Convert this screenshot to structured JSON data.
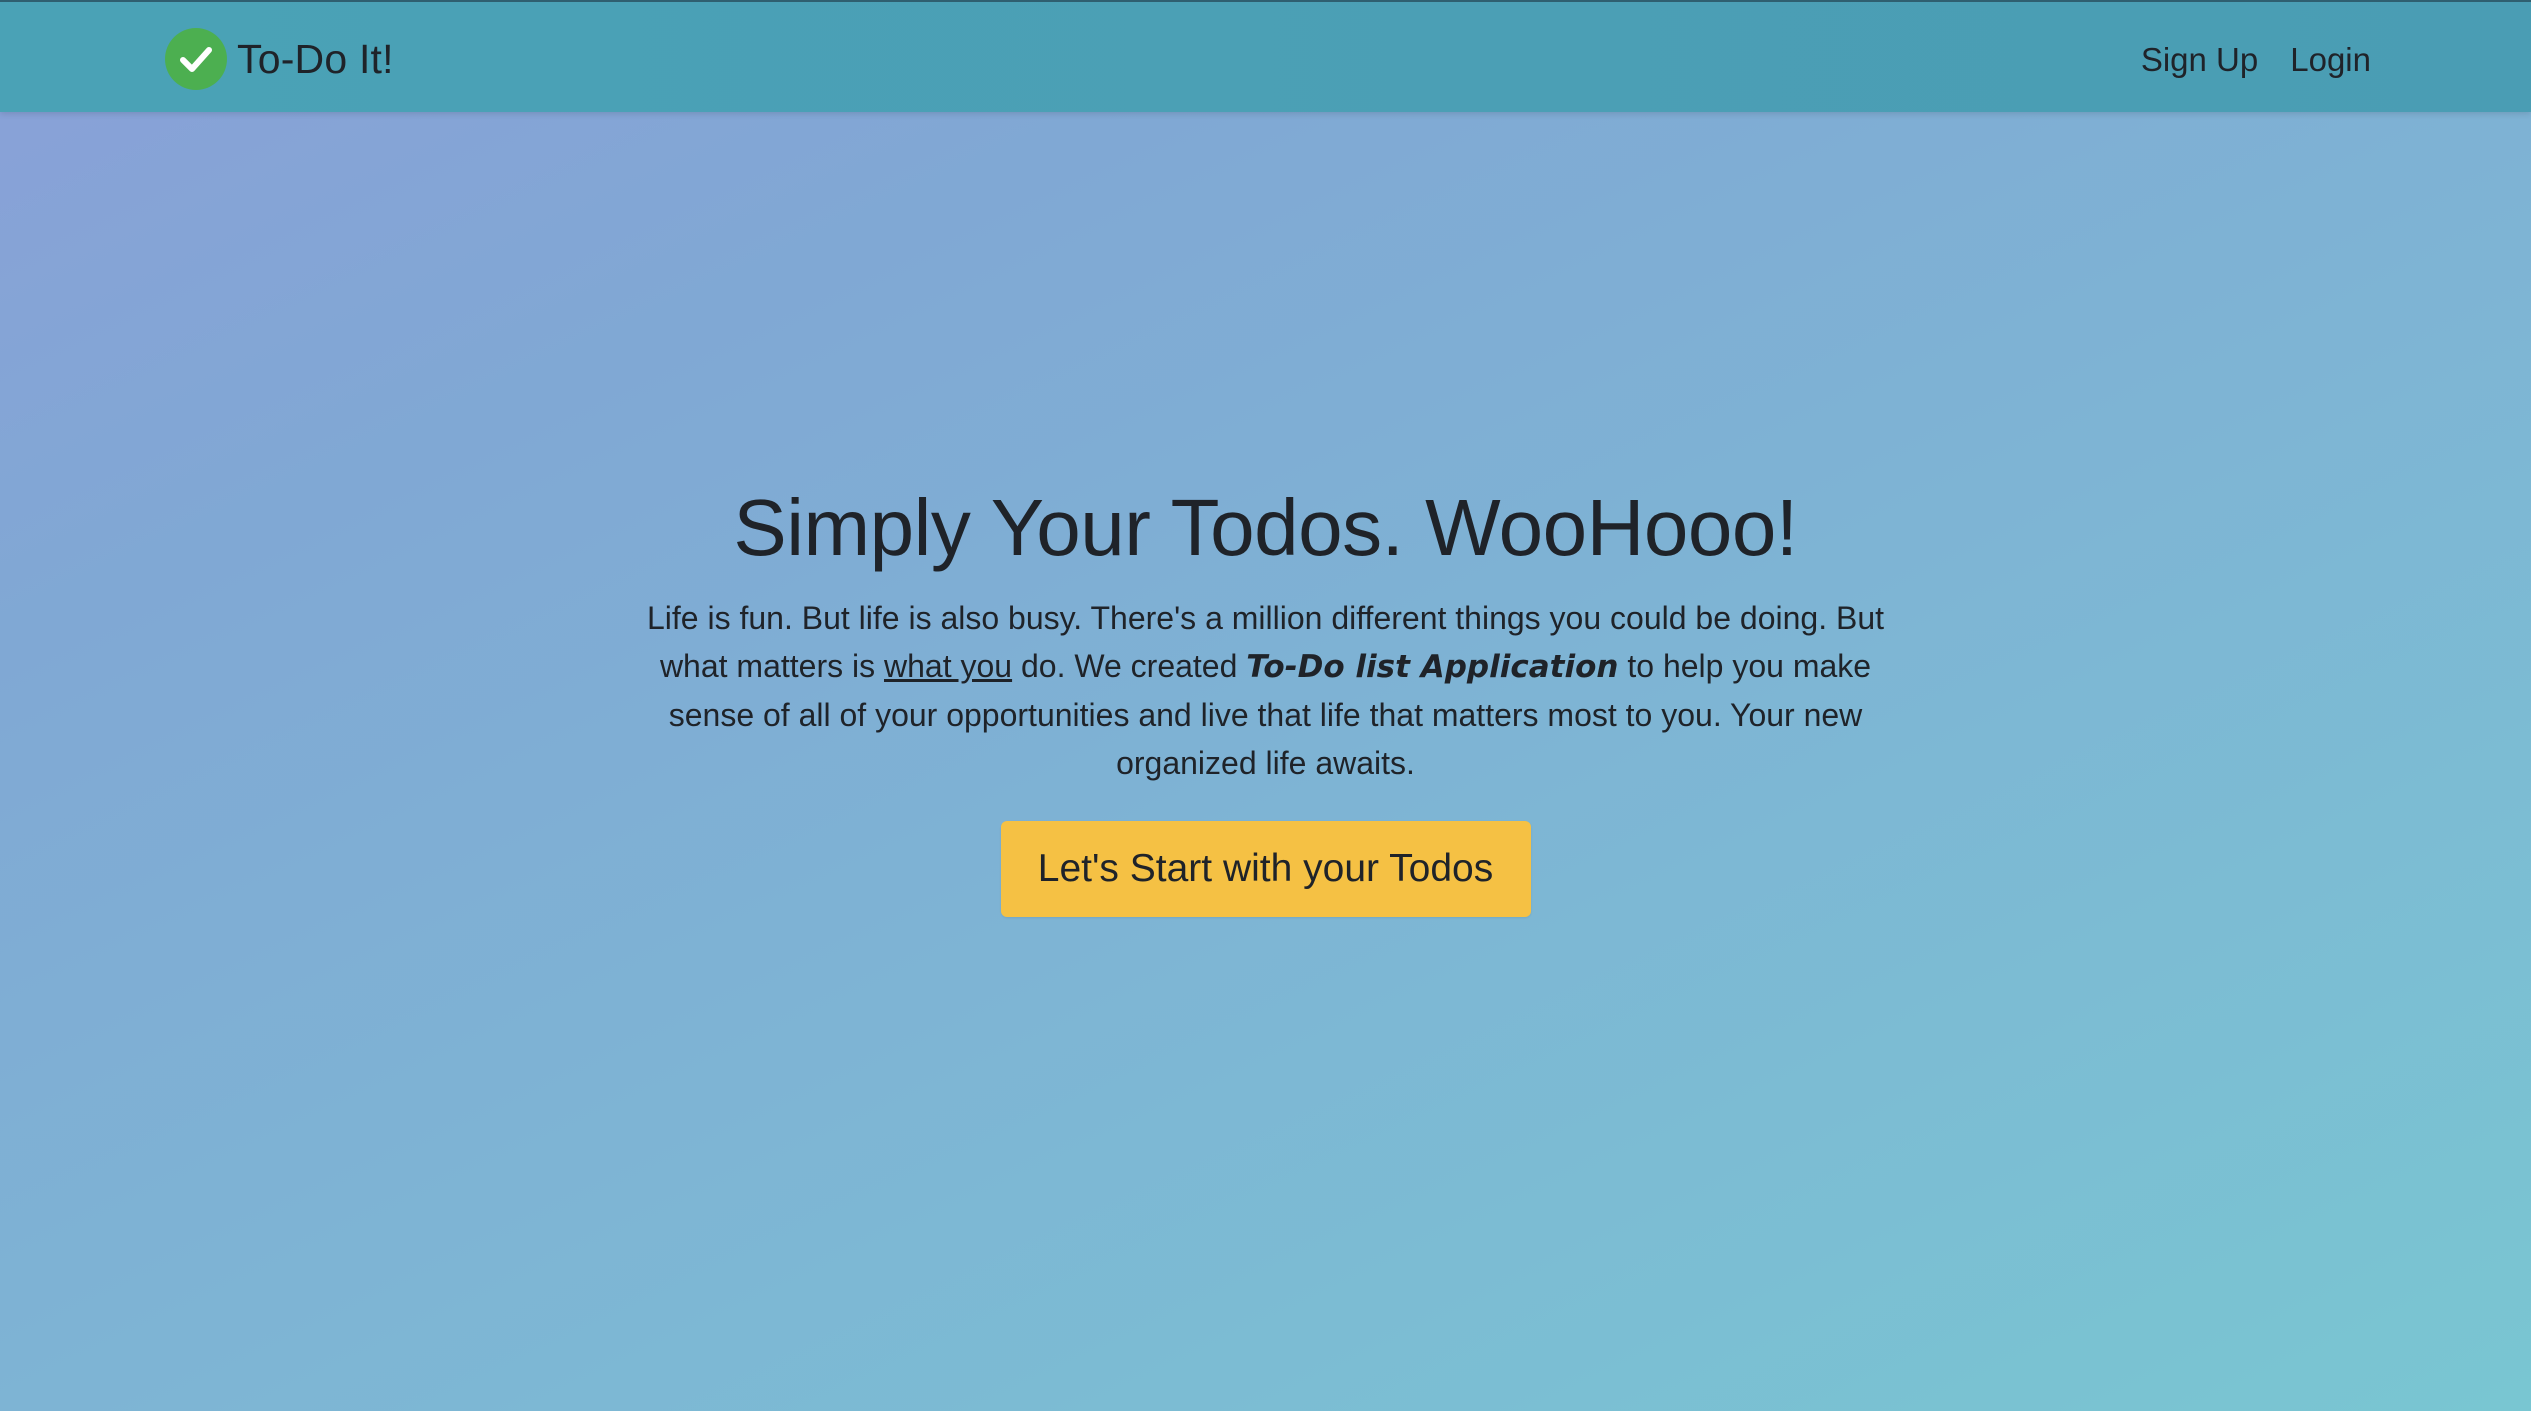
{
  "nav": {
    "brand_name": "To-Do It!",
    "brand_icon": "check-circle-icon",
    "signup_label": "Sign Up",
    "login_label": "Login"
  },
  "hero": {
    "title": "Simply Your Todos. WooHooo!",
    "text_part1": "Life is fun. But life is also busy. There's a million different things you could be doing. But what matters is ",
    "text_underlined": "what you",
    "text_part2": " do. We created ",
    "text_app_name": "To-Do list Application",
    "text_part3": " to help you make sense of all of your opportunities and live that life that matters most to you. Your new organized life awaits.",
    "cta_label": "Let's Start with your Todos"
  },
  "colors": {
    "navbar": "#4aa2b6",
    "brand_icon": "#4caf50",
    "cta_button": "#f5c144",
    "text": "#1f2329"
  }
}
